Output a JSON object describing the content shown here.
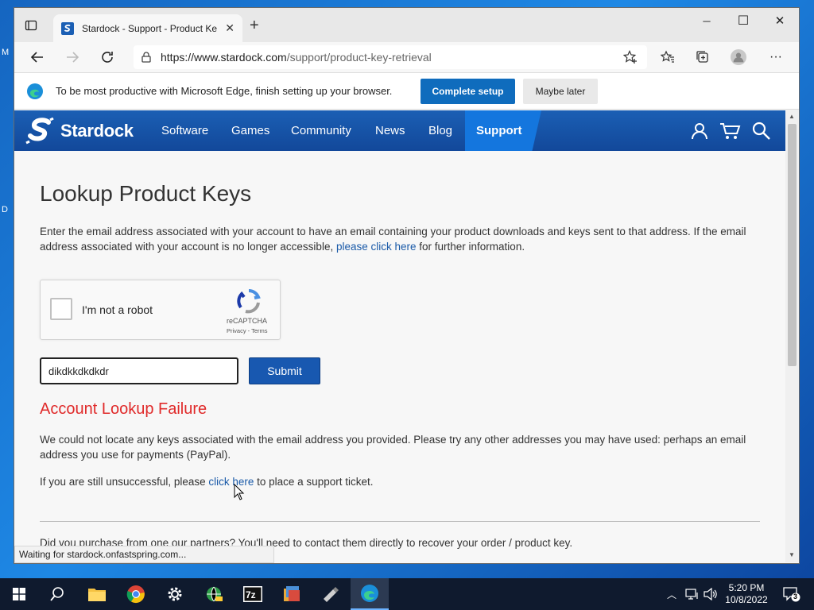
{
  "desktop": {
    "frag_top": "M",
    "frag_mid": "D"
  },
  "browser": {
    "tab_title": "Stardock - Support - Product Key Retrieval",
    "new_tab": "+",
    "url_domain": "https://www.stardock.com",
    "url_path": "/support/product-key-retrieval",
    "minimize": "─",
    "maximize": "☐",
    "close": "✕"
  },
  "infobar": {
    "message": "To be most productive with Microsoft Edge, finish setting up your browser.",
    "primary_label": "Complete setup",
    "secondary_label": "Maybe later"
  },
  "site": {
    "logo_text": "Stardock",
    "nav": [
      "Software",
      "Games",
      "Community",
      "News",
      "Blog"
    ],
    "nav_active": "Support",
    "brand_color": "#1b5fb4"
  },
  "page": {
    "title": "Lookup Product Keys",
    "intro_before_link": "Enter the email address associated with your account to have an email containing your product downloads and keys sent to that address. If the email address associated with your account is no longer accessible, ",
    "intro_link": "please click here",
    "intro_after_link": " for further information.",
    "captcha_label": "I'm not a robot",
    "captcha_brand": "reCAPTCHA",
    "captcha_terms": "Privacy - Terms",
    "email_value": "dikdkkdkdkdr",
    "submit_label": "Submit",
    "fail_title": "Account Lookup Failure",
    "fail_text": "We could not locate any keys associated with the email address you provided. Please try any other addresses you may have used: perhaps an email address you use for payments (PayPal).",
    "unsucc_before": "If you are still unsuccessful, please ",
    "unsucc_link": "click here",
    "unsucc_after": " to place a support ticket.",
    "partners_text": "Did you purchase from one our partners? You'll need to contact them directly to recover your order / product key."
  },
  "status": {
    "text": "Waiting for stardock.onfastspring.com..."
  },
  "taskbar": {
    "time": "5:20 PM",
    "date": "10/8/2022",
    "notification_count": "3"
  }
}
